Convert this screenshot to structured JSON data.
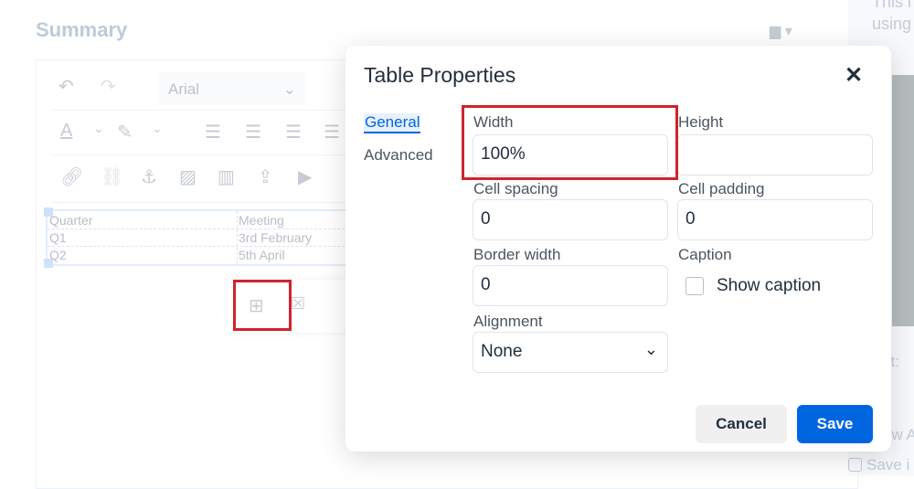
{
  "background": {
    "page_title": "Summary",
    "font_select": "Arial",
    "table": {
      "headers": [
        "Quarter",
        "Meeting"
      ],
      "rows": [
        [
          "Q1",
          "3rd February"
        ],
        [
          "Q2",
          "5th April"
        ]
      ]
    },
    "right_panel": {
      "text_line1": "This i",
      "text_line2": "using",
      "text_label": "xt:",
      "text_allow": "ow A",
      "save_checkbox": "Save i"
    }
  },
  "dialog": {
    "title": "Table Properties",
    "tabs": [
      {
        "label": "General",
        "active": true
      },
      {
        "label": "Advanced",
        "active": false
      }
    ],
    "fields": {
      "width": {
        "label": "Width",
        "value": "100%"
      },
      "height": {
        "label": "Height",
        "value": ""
      },
      "cell_spacing": {
        "label": "Cell spacing",
        "value": "0"
      },
      "cell_padding": {
        "label": "Cell padding",
        "value": "0"
      },
      "border_width": {
        "label": "Border width",
        "value": "0"
      },
      "caption": {
        "label": "Caption",
        "checkbox_label": "Show caption",
        "checked": false
      },
      "alignment": {
        "label": "Alignment",
        "value": "None"
      }
    },
    "cancel_label": "Cancel",
    "save_label": "Save"
  },
  "colors": {
    "accent": "#0066e0",
    "highlight": "#d0232f"
  }
}
